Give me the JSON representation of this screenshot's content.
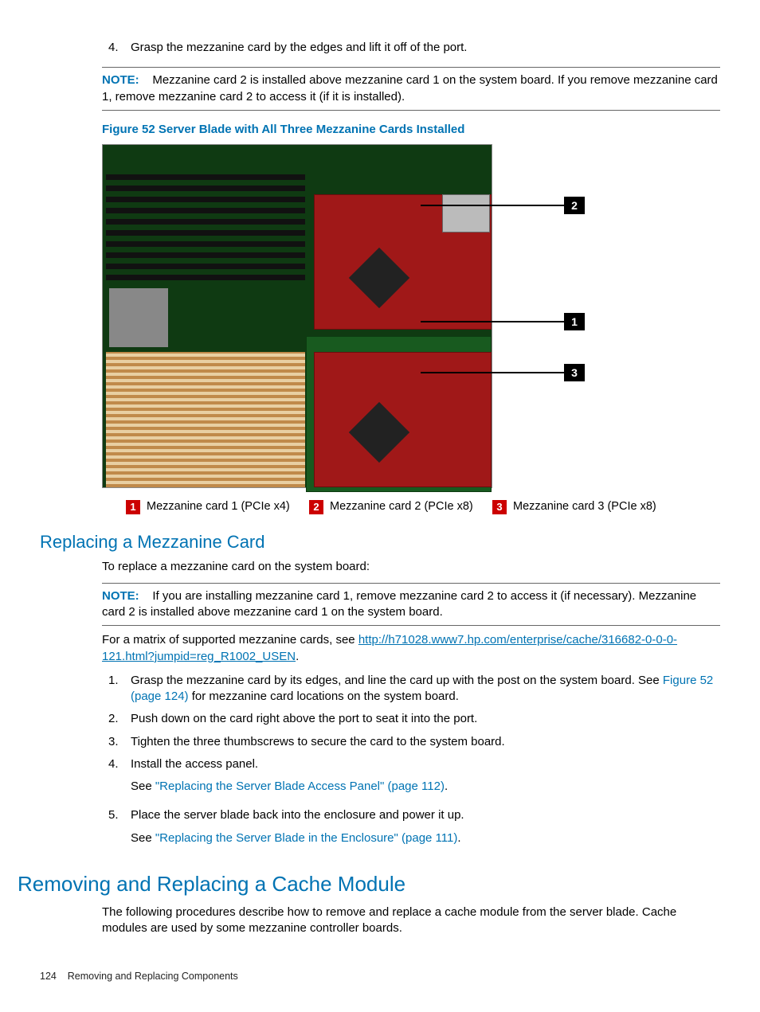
{
  "step4": {
    "num": "4.",
    "text": "Grasp the mezzanine card by the edges and lift it off of the port."
  },
  "note1": {
    "label": "NOTE:",
    "text": "Mezzanine card 2 is installed above mezzanine card 1 on the system board. If you remove mezzanine card 1, remove mezzanine card 2 to access it (if it is installed)."
  },
  "figure": {
    "title": "Figure 52 Server Blade with All Three Mezzanine Cards Installed",
    "callouts": {
      "c1": "1",
      "c2": "2",
      "c3": "3"
    }
  },
  "legend": {
    "i1": {
      "num": "1",
      "text": "Mezzanine card 1 (PCIe x4)"
    },
    "i2": {
      "num": "2",
      "text": "Mezzanine card 2 (PCIe x8)"
    },
    "i3": {
      "num": "3",
      "text": "Mezzanine card 3 (PCIe x8)"
    }
  },
  "h2_replace": "Replacing a Mezzanine Card",
  "intro_replace": "To replace a mezzanine card on the system board:",
  "note2": {
    "label": "NOTE:",
    "text": "If you are installing mezzanine card 1, remove mezzanine card 2 to access it (if necessary). Mezzanine card 2 is installed above mezzanine card 1 on the system board."
  },
  "matrix": {
    "pre": "For a matrix of supported mezzanine cards, see ",
    "url": "http://h71028.www7.hp.com/enterprise/cache/316682-0-0-0-121.html?jumpid=reg_R1002_USEN",
    "post": "."
  },
  "steps": {
    "s1": {
      "num": "1.",
      "text_a": "Grasp the mezzanine card by its edges, and line the card up with the post on the system board. See ",
      "xref": "Figure 52 (page 124)",
      "text_b": " for mezzanine card locations on the system board."
    },
    "s2": {
      "num": "2.",
      "text": "Push down on the card right above the port to seat it into the port."
    },
    "s3": {
      "num": "3.",
      "text": "Tighten the three thumbscrews to secure the card to the system board."
    },
    "s4": {
      "num": "4.",
      "text": "Install the access panel.",
      "see_pre": "See ",
      "see_link": "\"Replacing the Server Blade Access Panel\" (page 112)",
      "see_post": "."
    },
    "s5": {
      "num": "5.",
      "text": "Place the server blade back into the enclosure and power it up.",
      "see_pre": "See ",
      "see_link": "\"Replacing the Server Blade in the Enclosure\" (page 111)",
      "see_post": "."
    }
  },
  "h1_cache": "Removing and Replacing a Cache Module",
  "cache_intro": "The following procedures describe how to remove and replace a cache module from the server blade. Cache modules are used by some mezzanine controller boards.",
  "footer": {
    "page": "124",
    "title": "Removing and Replacing Components"
  }
}
